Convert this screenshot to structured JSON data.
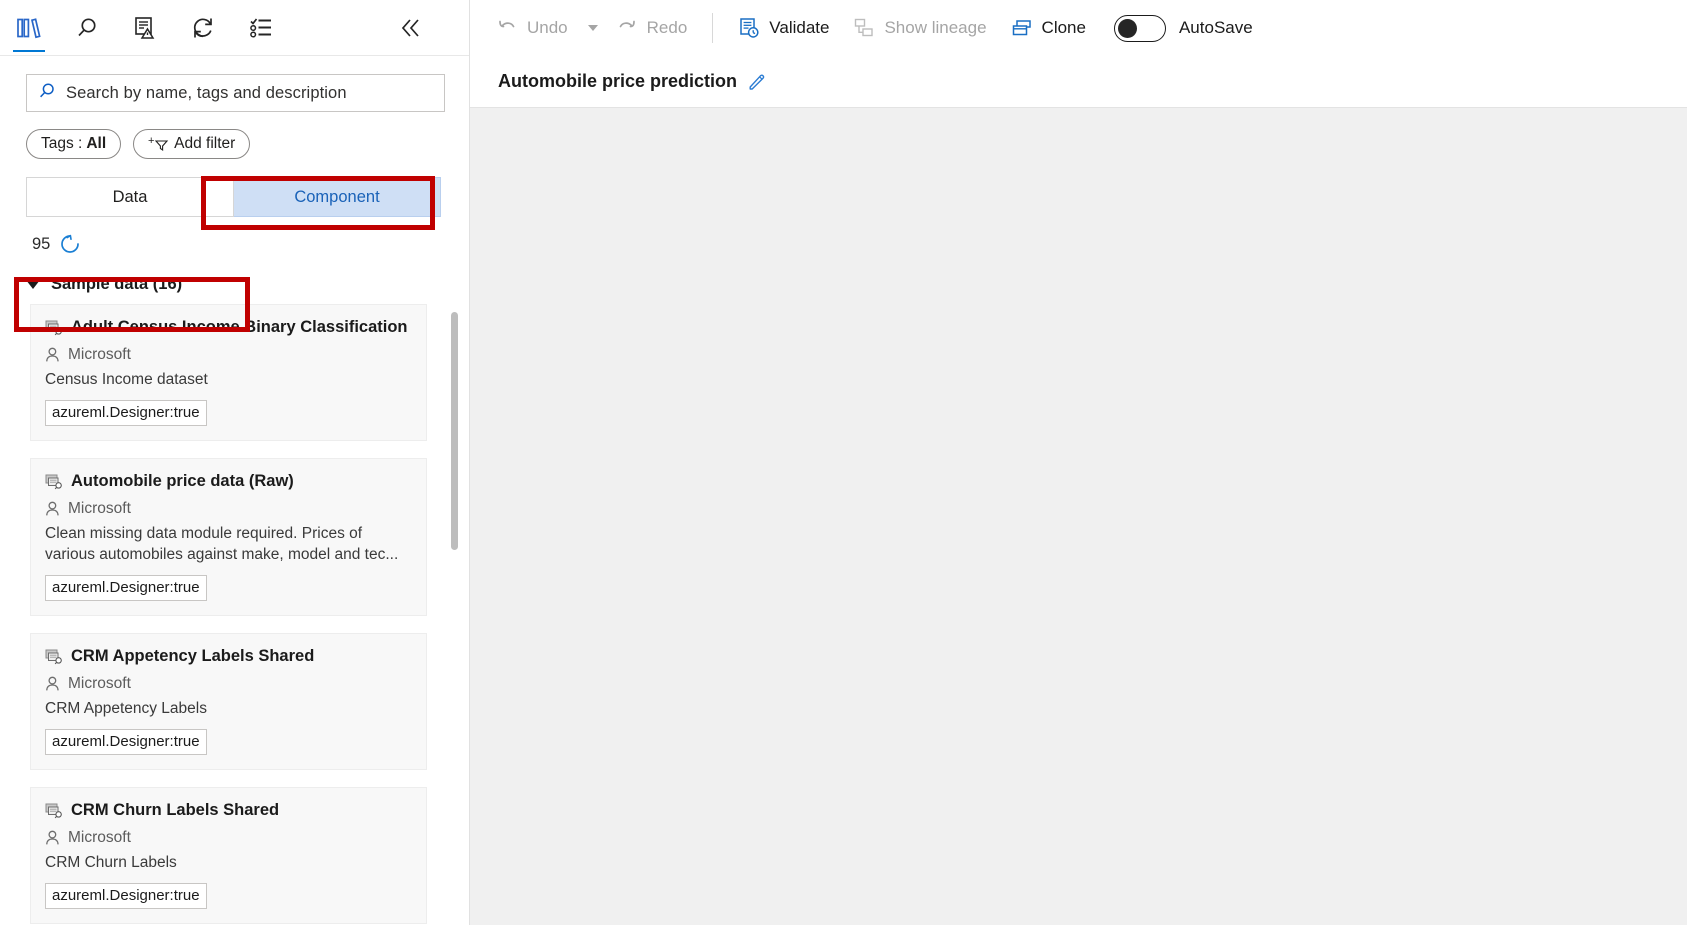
{
  "left_rail": {
    "icons": [
      {
        "name": "asset-library-icon",
        "title": "Asset library",
        "active": true
      },
      {
        "name": "search-icon",
        "title": "Search",
        "active": false
      },
      {
        "name": "submitted-jobs-icon",
        "title": "Submitted jobs",
        "active": false
      },
      {
        "name": "refresh-icon",
        "title": "Refresh",
        "active": false
      },
      {
        "name": "settings-list-icon",
        "title": "Settings",
        "active": false
      }
    ],
    "collapse": {
      "name": "collapse-panel-icon",
      "glyph": "«",
      "title": "Collapse"
    }
  },
  "search": {
    "placeholder": "Search by name, tags and description",
    "value": "",
    "icon": "search-icon"
  },
  "filters": {
    "tags_label_prefix": "Tags : ",
    "tags_label_value": "All",
    "add_filter_label": "Add filter",
    "add_filter_icon": "add-filter-icon"
  },
  "tabs": [
    {
      "label": "Data",
      "selected": false
    },
    {
      "label": "Component",
      "selected": true
    }
  ],
  "count": {
    "value": "95",
    "refresh_icon": "refresh-spinner-icon"
  },
  "group": {
    "label": "Sample data (16)",
    "expanded": true,
    "caret_icon": "caret-down-icon"
  },
  "cards": [
    {
      "title": "Adult Census Income Binary Classification dat...",
      "owner": "Microsoft",
      "description": "Census Income dataset",
      "tag": "azureml.Designer:true",
      "type_icon": "dataset-icon",
      "owner_icon": "person-icon"
    },
    {
      "title": "Automobile price data (Raw)",
      "owner": "Microsoft",
      "description": "Clean missing data module required. Prices of various automobiles against make, model and tec...",
      "tag": "azureml.Designer:true",
      "type_icon": "dataset-icon",
      "owner_icon": "person-icon"
    },
    {
      "title": "CRM Appetency Labels Shared",
      "owner": "Microsoft",
      "description": "CRM Appetency Labels",
      "tag": "azureml.Designer:true",
      "type_icon": "dataset-icon",
      "owner_icon": "person-icon"
    },
    {
      "title": "CRM Churn Labels Shared",
      "owner": "Microsoft",
      "description": "CRM Churn Labels",
      "tag": "azureml.Designer:true",
      "type_icon": "dataset-icon",
      "owner_icon": "person-icon"
    }
  ],
  "toolbar": {
    "undo_label": "Undo",
    "undo_icon": "undo-icon",
    "undo_dropdown_icon": "chevron-down-icon",
    "redo_label": "Redo",
    "redo_icon": "redo-icon",
    "validate_label": "Validate",
    "validate_icon": "validate-icon",
    "show_lineage_label": "Show lineage",
    "show_lineage_icon": "lineage-icon",
    "clone_label": "Clone",
    "clone_icon": "clone-icon",
    "autosave_label": "AutoSave",
    "autosave_on": false
  },
  "pipeline": {
    "title": "Automobile price prediction",
    "edit_icon": "pencil-icon"
  },
  "colors": {
    "accent": "#0078d4",
    "annotation": "#c00000",
    "tab_selected_bg": "#cfdff5",
    "tab_selected_text": "#1a62b8",
    "canvas_bg": "#f0f0f0",
    "card_bg": "#f8f8f8"
  }
}
